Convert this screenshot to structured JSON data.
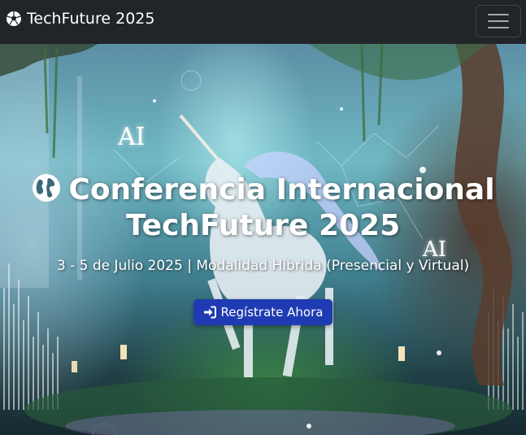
{
  "navbar": {
    "brand_name": "TechFuture 2025",
    "brand_icon": "soccer-ball-icon",
    "menu_icon": "hamburger-menu-icon"
  },
  "hero": {
    "title_icon": "globe-icon",
    "title_line1": "Conferencia Internacional",
    "title_line2": "TechFuture 2025",
    "subtitle": "3 - 5 de Julio 2025 | Modalidad Híbrida (Presencial y Virtual)",
    "cta_label": "Regístrate Ahora",
    "cta_icon": "sign-in-icon",
    "image_labels": [
      "AI",
      "AI"
    ],
    "colors": {
      "navbar_bg": "#212529",
      "cta_bg": "#1f3bb3",
      "text": "#ffffff"
    }
  }
}
